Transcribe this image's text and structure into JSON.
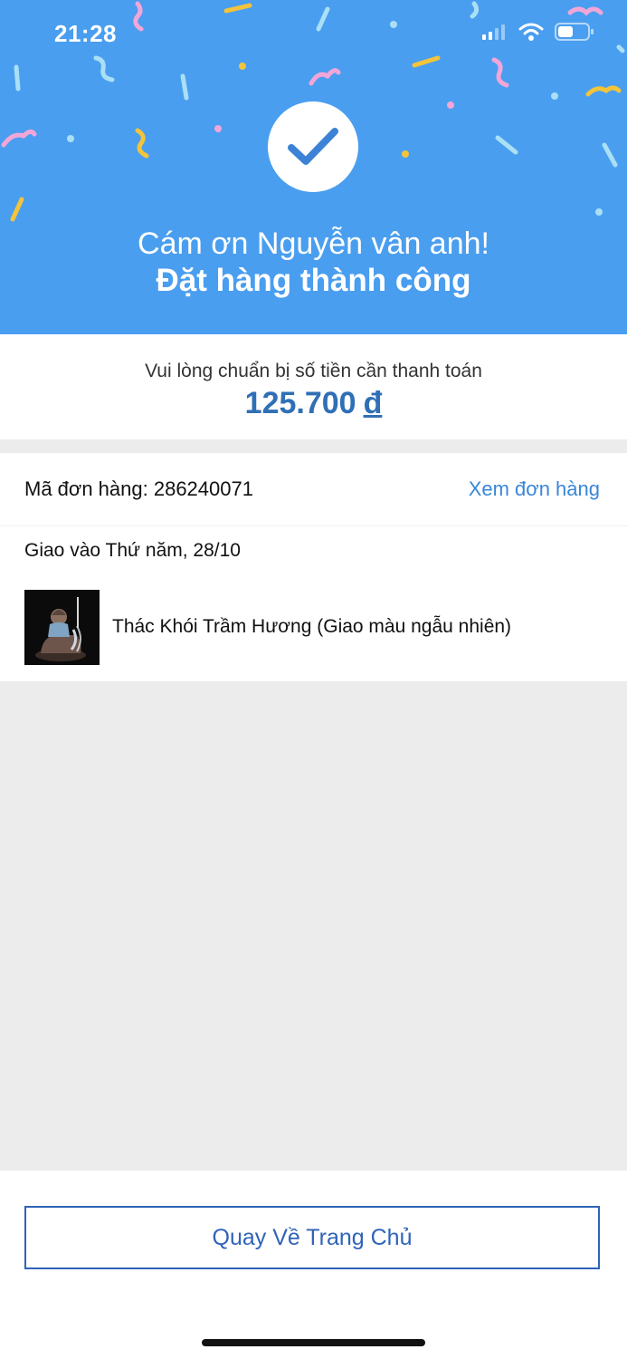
{
  "status_bar": {
    "time": "21:28",
    "icons": [
      "signal-icon",
      "wifi-icon",
      "battery-icon"
    ]
  },
  "header": {
    "background_color": "#4a9eef",
    "thanks_text": "Cám ơn Nguyễn vân anh!",
    "success_text": "Đặt hàng thành công",
    "icon": "checkmark-icon"
  },
  "payment": {
    "label": "Vui lòng chuẩn bị số tiền cần thanh toán",
    "amount": "125.700",
    "currency": "đ",
    "amount_color": "#2f6fb5"
  },
  "order": {
    "code_text": "Mã đơn hàng: 286240071",
    "view_order_label": "Xem đơn hàng",
    "delivery_text": "Giao vào Thứ năm, 28/10",
    "product_name": "Thác Khói Trầm Hương (Giao màu ngẫu nhiên)",
    "link_color": "#3a86d8"
  },
  "footer": {
    "home_button_label": "Quay Về Trang Chủ",
    "button_color": "#2f63b8"
  }
}
